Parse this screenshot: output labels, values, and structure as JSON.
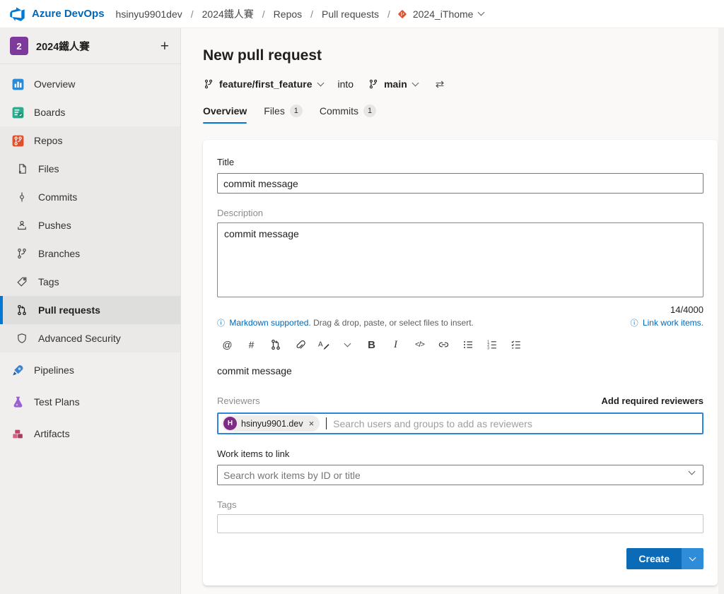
{
  "topbar": {
    "brand": "Azure DevOps",
    "separator": "/",
    "crumbs": [
      "hsinyu9901dev",
      "2024鐵人賽",
      "Repos",
      "Pull requests"
    ],
    "repo": {
      "name": "2024_iThome"
    }
  },
  "sidebar": {
    "project": {
      "initial": "2",
      "name": "2024鐵人賽",
      "add_button": "+"
    },
    "items": [
      {
        "label": "Overview",
        "icon": "overview-icon"
      },
      {
        "label": "Boards",
        "icon": "boards-icon"
      },
      {
        "label": "Repos",
        "icon": "repos-icon"
      },
      {
        "label": "Files",
        "icon": "files-icon"
      },
      {
        "label": "Commits",
        "icon": "commits-icon"
      },
      {
        "label": "Pushes",
        "icon": "pushes-icon"
      },
      {
        "label": "Branches",
        "icon": "branches-icon"
      },
      {
        "label": "Tags",
        "icon": "tags-icon"
      },
      {
        "label": "Pull requests",
        "icon": "pull-requests-icon",
        "selected": true
      },
      {
        "label": "Advanced Security",
        "icon": "shield-icon"
      },
      {
        "label": "Pipelines",
        "icon": "pipelines-icon"
      },
      {
        "label": "Test Plans",
        "icon": "test-plans-icon"
      },
      {
        "label": "Artifacts",
        "icon": "artifacts-icon"
      }
    ]
  },
  "main": {
    "title": "New pull request",
    "branch": {
      "source": "feature/first_feature",
      "into": "into",
      "target": "main"
    },
    "tabs": [
      {
        "label": "Overview",
        "active": true
      },
      {
        "label": "Files",
        "badge": "1"
      },
      {
        "label": "Commits",
        "badge": "1"
      }
    ],
    "toolbar": [
      {
        "name": "mention-icon",
        "glyph": "@"
      },
      {
        "name": "work-item-icon",
        "glyph": "#"
      },
      {
        "name": "pull-request-icon"
      },
      {
        "name": "attachment-icon"
      },
      {
        "name": "format-icon"
      },
      {
        "name": "format-dropdown-chevron-icon"
      },
      {
        "name": "bold-icon",
        "glyph": "B"
      },
      {
        "name": "italic-icon",
        "glyph": "I"
      },
      {
        "name": "code-icon",
        "glyph": "</>"
      },
      {
        "name": "link-icon"
      },
      {
        "name": "bulleted-list-icon"
      },
      {
        "name": "numbered-list-icon"
      },
      {
        "name": "task-list-icon"
      }
    ],
    "form": {
      "title_label": "Title",
      "title_value": "commit message",
      "description_label": "Description",
      "description_value": "commit message",
      "char_counter": "14/4000",
      "info_icon": "ⓘ",
      "markdown_link": "Markdown supported.",
      "markdown_hint": "Drag & drop, paste, or select files to insert.",
      "link_work_items": "Link work items.",
      "preview_text": "commit message",
      "reviewers_label": "Reviewers",
      "add_required_reviewers": "Add required reviewers",
      "reviewer_chip": {
        "initial": "H",
        "name": "hsinyu9901.dev",
        "remove": "×"
      },
      "reviewers_placeholder": "Search users and groups to add as reviewers",
      "work_items_label": "Work items to link",
      "work_items_placeholder": "Search work items by ID or title",
      "tags_label": "Tags",
      "create_label": "Create"
    }
  },
  "colors": {
    "accent_blue": "#0078d4",
    "brand_blue": "#0067b8",
    "create_button": "#0b6bb7",
    "create_dropdown": "#2e8cd8",
    "repos_orange": "#e0502c",
    "project_avatar_purple": "#7d3a9b",
    "reviewer_avatar_purple": "#7e2b86",
    "sidebar_bg": "#f1efee",
    "selected_row_bg": "#dededd"
  }
}
